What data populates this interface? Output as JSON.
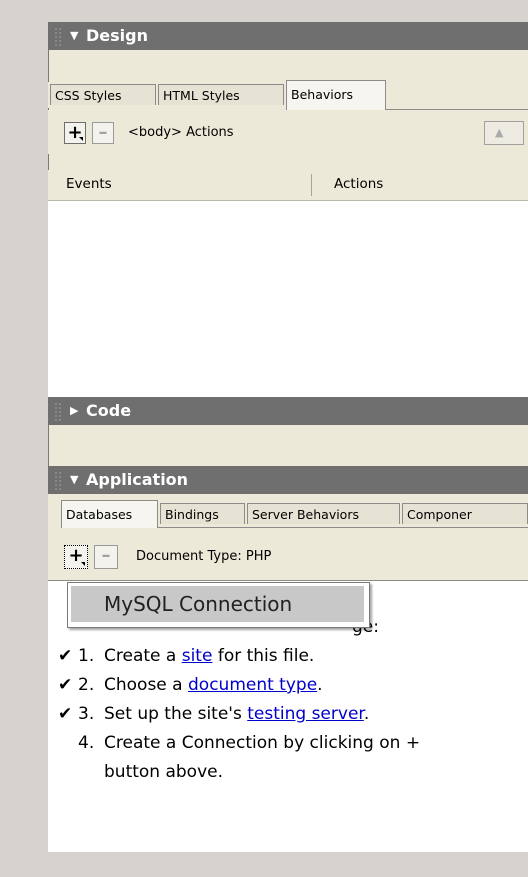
{
  "design": {
    "title": "Design",
    "tabs": [
      "CSS Styles",
      "HTML Styles",
      "Behaviors"
    ],
    "toolbar_label": "<body> Actions",
    "columns": [
      "Events",
      "Actions"
    ]
  },
  "code": {
    "title": "Code"
  },
  "application": {
    "title": "Application",
    "tabs": [
      "Databases",
      "Bindings",
      "Server Behaviors",
      "Componer"
    ],
    "toolbar_label": "Document Type: PHP",
    "menu_item": "MySQL Connection",
    "intro_tail": "ge:",
    "steps": [
      {
        "num": "1.",
        "pre": "Create a ",
        "link": "site",
        "post": " for this file.",
        "checked": true
      },
      {
        "num": "2.",
        "pre": "Choose a ",
        "link": "document type",
        "post": ".",
        "checked": true
      },
      {
        "num": "3.",
        "pre": "Set up the site's ",
        "link": "testing server",
        "post": ".",
        "checked": true
      },
      {
        "num": "4.",
        "pre": "Create a Connection by clicking on +",
        "link": "",
        "post": "",
        "checked": false
      }
    ],
    "step4_line2": "button above."
  },
  "icons": {
    "expanded": "triangle-down",
    "collapsed": "triangle-right",
    "check": "checkmark",
    "plus": "plus",
    "minus": "minus"
  }
}
